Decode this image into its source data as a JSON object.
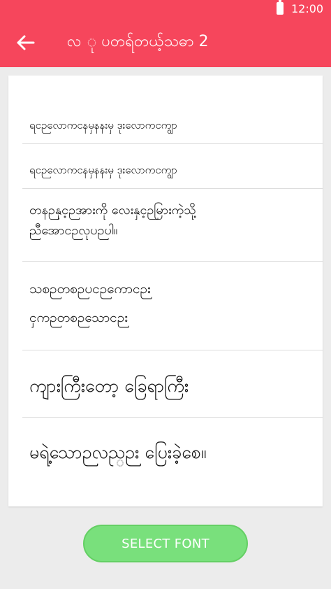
{
  "status_bar": {
    "time": "12:00",
    "battery_icon": "battery-full-icon"
  },
  "app_bar": {
    "back_icon": "arrow-left-icon",
    "title": "လ ု ပတရ်တယ့်သဓာ 2"
  },
  "preview": {
    "rows": [
      {
        "text": "ရငဉလောကငနမှနနးမှ ဒုးလောကငကျွာ"
      },
      {
        "text": "ရငဉလောကငနမှနနးမှ ဒုးလောကငကျွာ"
      },
      {
        "line1": "တနဉနှင့ဉအားကို လေးနှင့ဉမြားကဲ့သို့",
        "line2": "ညီအောငဉလုပဉပါ။"
      },
      {
        "line1": "သစဉတစဉပငဉကောငဉး",
        "line2": "ငှကဉတစဉသောငဉး"
      },
      {
        "text": "ကျားကြီးတော့ ခြေရာကြီး"
      },
      {
        "text": "မရဲ့သောဉလည္ဉး ပြေးခဲ့စေ။"
      }
    ]
  },
  "select_button": {
    "label": "SELECT FONT"
  },
  "colors": {
    "accent": "#f6465c",
    "button": "#79e07c",
    "background": "#ececec"
  }
}
